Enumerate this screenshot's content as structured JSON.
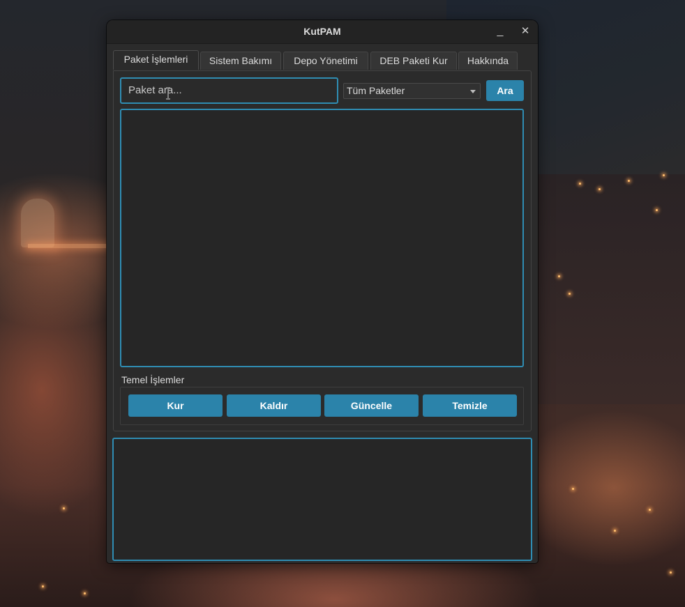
{
  "window": {
    "title": "KutPAM",
    "minimize_glyph": "_",
    "close_glyph": "✕"
  },
  "tabs": [
    {
      "label": "Paket İşlemleri",
      "active": true
    },
    {
      "label": "Sistem Bakımı",
      "active": false
    },
    {
      "label": "Depo Yönetimi",
      "active": false
    },
    {
      "label": "DEB Paketi Kur",
      "active": false
    },
    {
      "label": "Hakkında",
      "active": false
    }
  ],
  "search": {
    "placeholder": "Paket ara...",
    "value": ""
  },
  "filter": {
    "selected": "Tüm Paketler"
  },
  "search_button": "Ara",
  "actions_group": {
    "title": "Temel İşlemler",
    "buttons": [
      "Kur",
      "Kaldır",
      "Güncelle",
      "Temizle"
    ]
  },
  "colors": {
    "accent": "#2f8db3",
    "button": "#2b83aa",
    "window_bg": "#2b2b2b",
    "titlebar_bg": "#232323"
  },
  "icons": {
    "dropdown": "chevron-down-icon",
    "text_cursor": "text-cursor-icon"
  }
}
